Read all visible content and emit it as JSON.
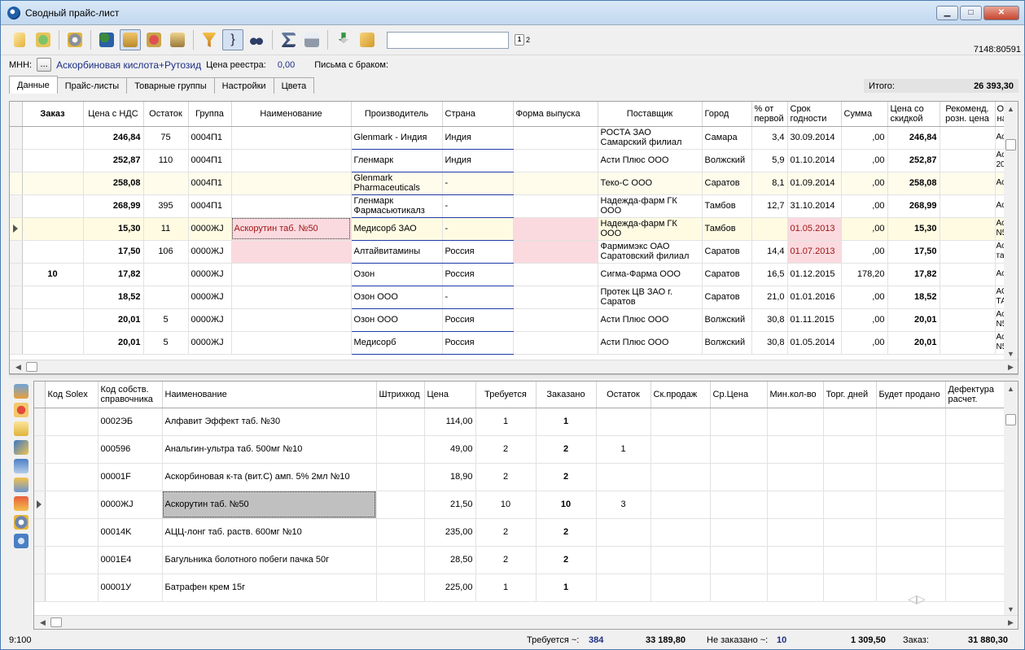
{
  "window": {
    "title": "Сводный прайс-лист",
    "min": "▁",
    "max": "□",
    "close": "✕"
  },
  "toolbar": {
    "code": "7148:80591",
    "page_a": "1",
    "page_b": "2"
  },
  "mnn": {
    "label": "МНН:",
    "button": "...",
    "value": "Аскорбиновая кислота+Рутозид",
    "price_label": "Цена реестра:",
    "price": "0,00",
    "letters_label": "Письма с браком:"
  },
  "tabs": [
    "Данные",
    "Прайс-листы",
    "Товарные группы",
    "Настройки",
    "Цвета"
  ],
  "itogo": {
    "label": "Итого:",
    "value": "26 393,30"
  },
  "grid1": {
    "columns": [
      "Заказ",
      "Цена с НДС",
      "Остаток",
      "Группа",
      "Наименование",
      "Производитель",
      "Страна",
      "Форма выпуска",
      "Поставщик",
      "Город",
      "% от первой",
      "Срок годности",
      "Сумма",
      "Цена со скидкой",
      "Рекоменд. розн. цена",
      "Ор на"
    ],
    "rows": [
      {
        "order": "",
        "price": "246,84",
        "stock": "75",
        "group": "0004П1",
        "name": "",
        "maker": "Glenmark - Индия",
        "country": "Индия",
        "form": "",
        "supplier": "РОСТА ЗАО Самарский филиал",
        "city": "Самара",
        "pct": "3,4",
        "expiry": "30.09.2014",
        "sum": ",00",
        "disc": "246,84",
        "rec": "",
        "orig": "Ас эк"
      },
      {
        "order": "",
        "price": "252,87",
        "stock": "110",
        "group": "0004П1",
        "name": "",
        "maker": "Гленмарк",
        "country": "Индия",
        "form": "",
        "supplier": "Асти Плюс ООО",
        "city": "Волжский",
        "pct": "5,9",
        "expiry": "01.10.2014",
        "sum": ",00",
        "disc": "252,87",
        "rec": "",
        "orig": "Ас 20"
      },
      {
        "order": "",
        "price": "258,08",
        "stock": "",
        "group": "0004П1",
        "name": "",
        "maker": "Glenmark Pharmaceuticals",
        "country": "-",
        "form": "",
        "supplier": "Теко-С ООО",
        "city": "Саратов",
        "pct": "8,1",
        "expiry": "01.09.2014",
        "sum": ",00",
        "disc": "258,08",
        "rec": "",
        "orig": "Ас эк"
      },
      {
        "order": "",
        "price": "268,99",
        "stock": "395",
        "group": "0004П1",
        "name": "",
        "maker": "Гленмарк Фармасьютикалз",
        "country": "-",
        "form": "",
        "supplier": "Надежда-фарм ГК ООО",
        "city": "Тамбов",
        "pct": "12,7",
        "expiry": "31.10.2014",
        "sum": ",00",
        "disc": "268,99",
        "rec": "",
        "orig": "Ас эк"
      },
      {
        "order": "",
        "price": "15,30",
        "stock": "11",
        "group": "0000ЖJ",
        "name": "Аскорутин таб. №50",
        "maker": "Медисорб ЗАО",
        "country": "-",
        "form": "",
        "supplier": "Надежда-фарм ГК ООО",
        "city": "Тамбов",
        "pct": "",
        "expiry": "01.05.2013",
        "sum": ",00",
        "disc": "15,30",
        "rec": "",
        "orig": "Ас N5"
      },
      {
        "order": "",
        "price": "17,50",
        "stock": "106",
        "group": "0000ЖJ",
        "name": "",
        "maker": "Алтайвитамины",
        "country": "Россия",
        "form": "",
        "supplier": "Фармимэкс ОАО Саратовский филиал",
        "city": "Саратов",
        "pct": "14,4",
        "expiry": "01.07.2013",
        "sum": ",00",
        "disc": "17,50",
        "rec": "",
        "orig": "Ас та"
      },
      {
        "order": "10",
        "price": "17,82",
        "stock": "",
        "group": "0000ЖJ",
        "name": "",
        "maker": "Озон",
        "country": "Россия",
        "form": "",
        "supplier": "Сигма-Фарма ООО",
        "city": "Саратов",
        "pct": "16,5",
        "expiry": "01.12.2015",
        "sum": "178,20",
        "disc": "17,82",
        "rec": "",
        "orig": "Ас эк"
      },
      {
        "order": "",
        "price": "18,52",
        "stock": "",
        "group": "0000ЖJ",
        "name": "",
        "maker": "Озон ООО",
        "country": "-",
        "form": "",
        "supplier": "Протек ЦВ ЗАО г. Саратов",
        "city": "Саратов",
        "pct": "21,0",
        "expiry": "01.01.2016",
        "sum": ",00",
        "disc": "18,52",
        "rec": "",
        "orig": "АС ТА"
      },
      {
        "order": "",
        "price": "20,01",
        "stock": "5",
        "group": "0000ЖJ",
        "name": "",
        "maker": "Озон ООО",
        "country": "Россия",
        "form": "",
        "supplier": "Асти Плюс ООО",
        "city": "Волжский",
        "pct": "30,8",
        "expiry": "01.11.2015",
        "sum": ",00",
        "disc": "20,01",
        "rec": "",
        "orig": "Ас N5"
      },
      {
        "order": "",
        "price": "20,01",
        "stock": "5",
        "group": "0000ЖJ",
        "name": "",
        "maker": "Медисорб",
        "country": "Россия",
        "form": "",
        "supplier": "Асти Плюс ООО",
        "city": "Волжский",
        "pct": "30,8",
        "expiry": "01.05.2014",
        "sum": ",00",
        "disc": "20,01",
        "rec": "",
        "orig": "Ас N5"
      }
    ]
  },
  "grid2": {
    "columns": [
      "Код Solex",
      "Код собств. справочника",
      "Наименование",
      "Штрихкод",
      "Цена",
      "Требуется",
      "Заказано",
      "Остаток",
      "Ск.продаж",
      "Ср.Цена",
      "Мин.кол-во",
      "Торг. дней",
      "Будет продано",
      "Дефектура расчет."
    ],
    "rows": [
      {
        "solex": "",
        "code": "0002ЭБ",
        "name": "Алфавит Эффект таб. №30",
        "barcode": "",
        "price": "114,00",
        "need": "1",
        "ordered": "1",
        "stock": ""
      },
      {
        "solex": "",
        "code": "000596",
        "name": "Анальгин-ультра таб. 500мг №10",
        "barcode": "",
        "price": "49,00",
        "need": "2",
        "ordered": "2",
        "stock": "1"
      },
      {
        "solex": "",
        "code": "00001F",
        "name": "Аскорбиновая к-та (вит.С) амп. 5% 2мл №10",
        "barcode": "",
        "price": "18,90",
        "need": "2",
        "ordered": "2",
        "stock": ""
      },
      {
        "solex": "",
        "code": "0000ЖJ",
        "name": "Аскорутин таб. №50",
        "barcode": "",
        "price": "21,50",
        "need": "10",
        "ordered": "10",
        "stock": "3"
      },
      {
        "solex": "",
        "code": "00014K",
        "name": "АЦЦ-лонг таб. раств. 600мг №10",
        "barcode": "",
        "price": "235,00",
        "need": "2",
        "ordered": "2",
        "stock": ""
      },
      {
        "solex": "",
        "code": "0001E4",
        "name": "Багульника болотного побеги пачка 50г",
        "barcode": "",
        "price": "28,50",
        "need": "2",
        "ordered": "2",
        "stock": ""
      },
      {
        "solex": "",
        "code": "00001У",
        "name": "Батрафен крем 15г",
        "barcode": "",
        "price": "225,00",
        "need": "1",
        "ordered": "1",
        "stock": ""
      }
    ]
  },
  "status": {
    "pos": "9:100",
    "need_label": "Требуется ~:",
    "need_count": "384",
    "need_sum": "33 189,80",
    "notordered_label": "Не заказано ~:",
    "notordered_count": "10",
    "notordered_sum": "1 309,50",
    "order_label": "Заказ:",
    "order_sum": "31 880,30"
  }
}
